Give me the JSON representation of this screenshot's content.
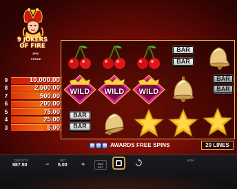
{
  "logo": {
    "line1": "9 JOKERS",
    "line2": "OF FIRE",
    "badge": "EPIC STRIKE"
  },
  "paytable": [
    {
      "count": "9",
      "value": "10,000.00"
    },
    {
      "count": "8",
      "value": "2,500.00"
    },
    {
      "count": "7",
      "value": "500.00"
    },
    {
      "count": "6",
      "value": "200.00"
    },
    {
      "count": "5",
      "value": "75.00"
    },
    {
      "count": "4",
      "value": "25.00"
    },
    {
      "count": "3",
      "value": "5.00"
    }
  ],
  "reels": [
    [
      "cherry",
      "wild",
      "bar"
    ],
    [
      "cherry",
      "wild",
      "bell"
    ],
    [
      "cherry",
      "wild",
      "star"
    ],
    [
      "bar",
      "bell",
      "star"
    ],
    [
      "bell",
      "bar",
      "star"
    ]
  ],
  "symbols": {
    "wild_label": "WILD",
    "bar_label": "BAR"
  },
  "awards": {
    "text": "AWARDS FREE SPINS"
  },
  "lines": "20 LINES",
  "footer": {
    "credits_label": "CREDITS",
    "credits_value": "987.50",
    "bet_label": "BET",
    "bet_value": "5.00",
    "minus": "−",
    "plus": "+",
    "maxbet_line1": "MAX",
    "maxbet_line2": "BET",
    "win_label": "WIN"
  },
  "colors": {
    "accent_gold": "#e7b74a",
    "paybar": "#e23305",
    "wild_pink": "#e5219a"
  }
}
